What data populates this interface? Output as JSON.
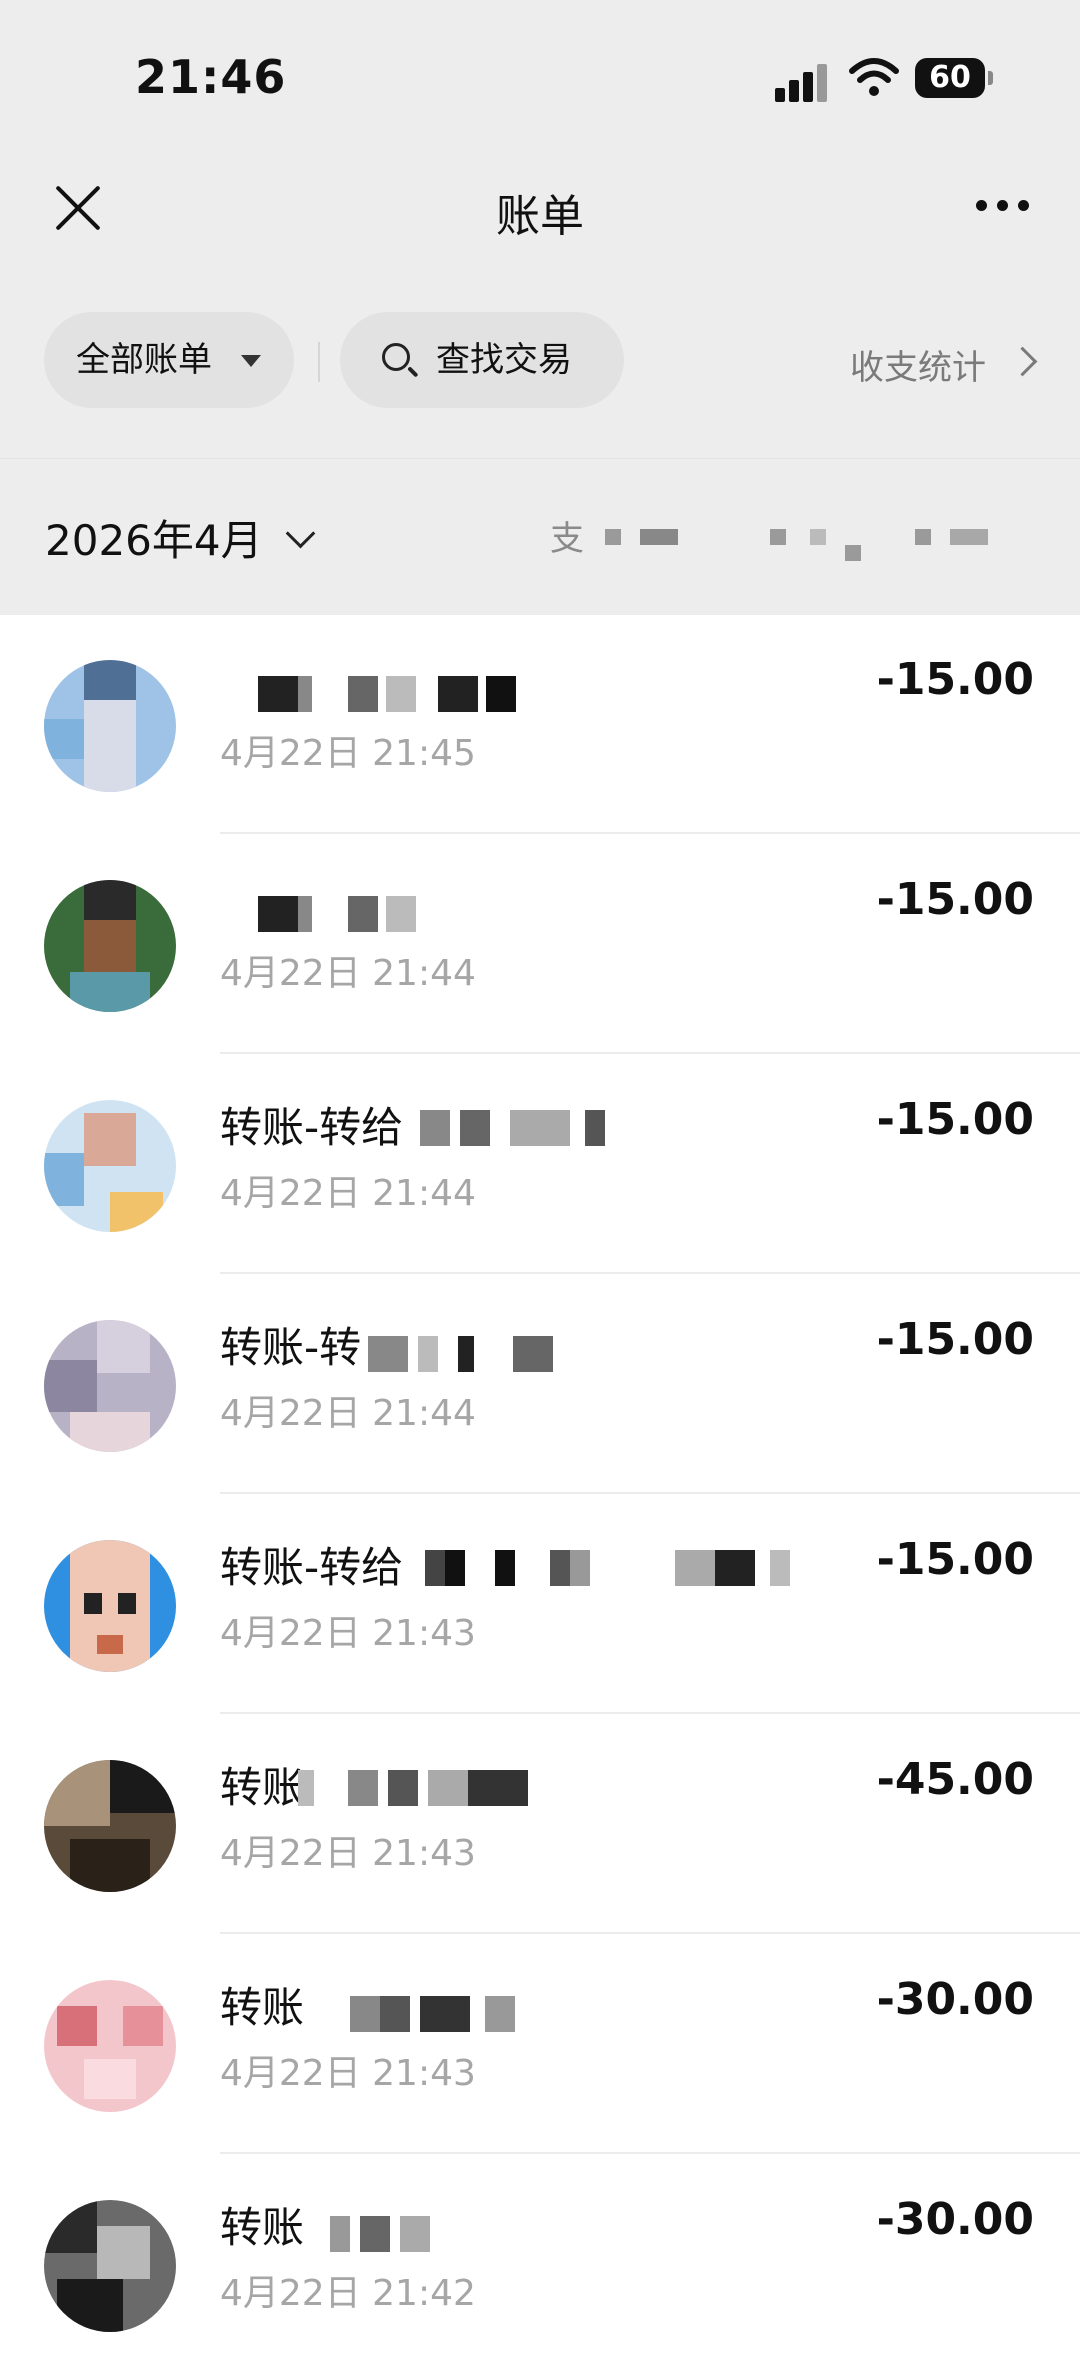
{
  "status_bar": {
    "time": "21:46",
    "battery": "60"
  },
  "nav": {
    "title": "账单"
  },
  "filters": {
    "all_bills": "全部账单",
    "search": "查找交易",
    "stats": "收支统计"
  },
  "month": {
    "label": "2026年4月",
    "summary_prefix": "支"
  },
  "transactions": [
    {
      "title": "",
      "time": "4月22日 21:45",
      "amount": "-15.00"
    },
    {
      "title": "",
      "time": "4月22日 21:44",
      "amount": "-15.00"
    },
    {
      "title": "转账-转给",
      "time": "4月22日 21:44",
      "amount": "-15.00"
    },
    {
      "title": "转账-转",
      "time": "4月22日 21:44",
      "amount": "-15.00"
    },
    {
      "title": "转账-转给",
      "time": "4月22日 21:43",
      "amount": "-15.00"
    },
    {
      "title": "转账",
      "time": "4月22日 21:43",
      "amount": "-45.00"
    },
    {
      "title": "转账",
      "time": "4月22日 21:43",
      "amount": "-30.00"
    },
    {
      "title": "转账",
      "time": "4月22日 21:42",
      "amount": "-30.00"
    }
  ],
  "icons": [
    "close-icon",
    "more-icon",
    "caret-down-icon",
    "search-icon",
    "chevron-right-icon",
    "chevron-down-icon"
  ]
}
